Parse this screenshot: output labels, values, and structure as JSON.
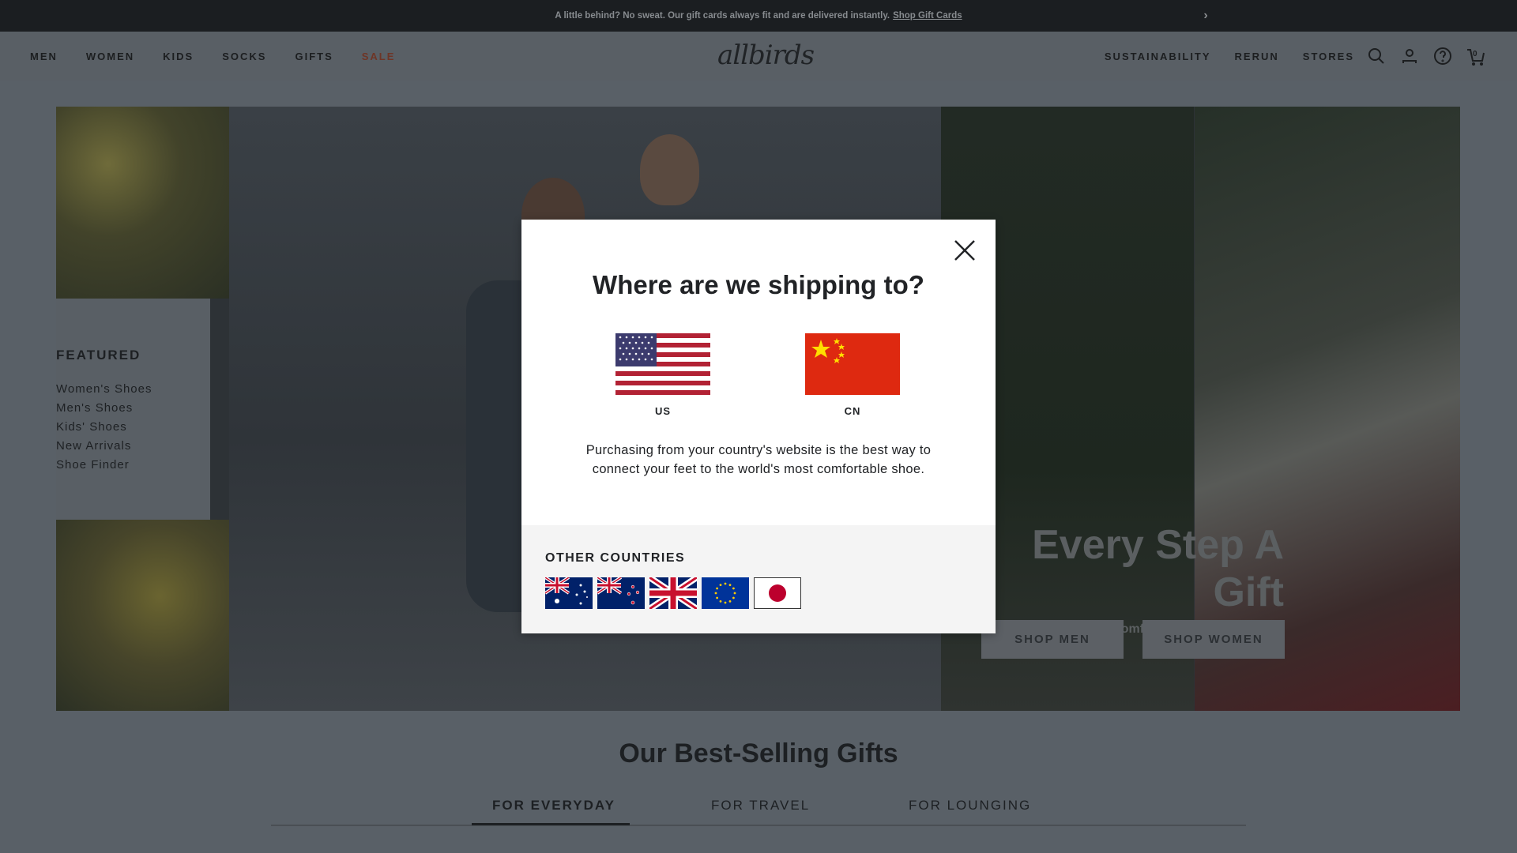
{
  "announcement": {
    "text": "A little behind? No sweat. Our gift cards always fit and are delivered instantly.",
    "link": "Shop Gift Cards"
  },
  "nav": {
    "left": [
      "MEN",
      "WOMEN",
      "KIDS",
      "SOCKS",
      "GIFTS",
      "SALE"
    ],
    "logo": "allbirds",
    "right": [
      "SUSTAINABILITY",
      "RERUN",
      "STORES"
    ],
    "cart_count": "0"
  },
  "featured": {
    "heading": "FEATURED",
    "items": [
      "Women's Shoes",
      "Men's Shoes",
      "Kids' Shoes",
      "New Arrivals",
      "Shoe Finder"
    ]
  },
  "hero": {
    "title": "Every Step A Gift",
    "subtitle": "Of presents are the comfiest, most-loved shoes.",
    "btn_men": "SHOP MEN",
    "btn_women": "SHOP WOMEN"
  },
  "best_selling": {
    "title": "Our Best-Selling Gifts",
    "tabs": [
      "FOR EVERYDAY",
      "FOR TRAVEL",
      "FOR LOUNGING"
    ],
    "active_tab": "FOR EVERYDAY"
  },
  "modal": {
    "title": "Where are we shipping to?",
    "countries": [
      "US",
      "CN"
    ],
    "description": "Purchasing from your country's website is the best way to connect your feet to the world's most comfortable shoe.",
    "other_heading": "OTHER COUNTRIES",
    "other_flags": [
      "australia-flag",
      "new-zealand-flag",
      "uk-flag",
      "eu-flag",
      "japan-flag"
    ]
  },
  "colors": {
    "overlay": "#596067",
    "modal_bg": "#ffffff",
    "other_bg": "#f4f4f4",
    "sale": "#6e3526"
  }
}
